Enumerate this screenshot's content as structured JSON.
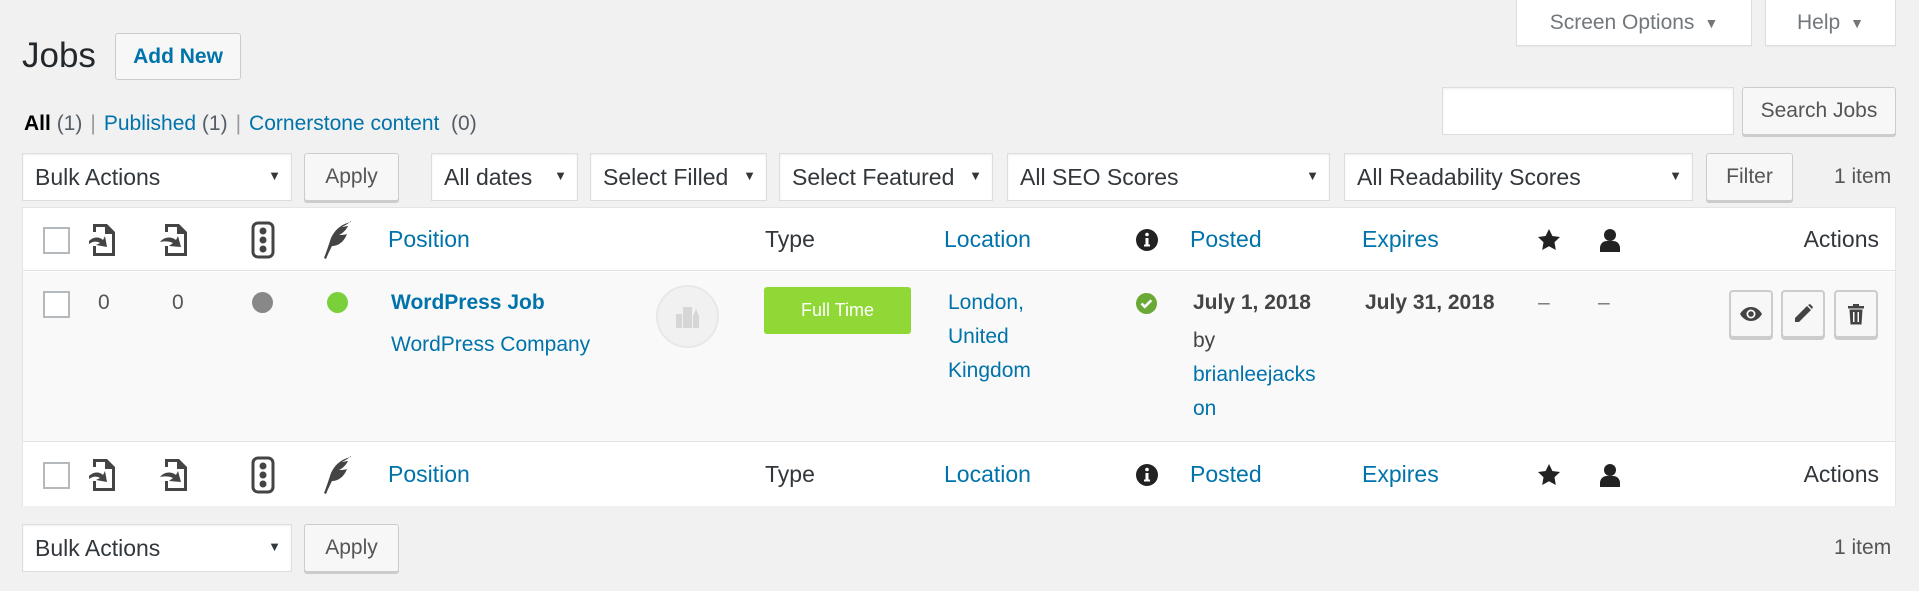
{
  "screen_meta": {
    "screen_options_label": "Screen Options",
    "help_label": "Help"
  },
  "header": {
    "title": "Jobs",
    "add_new_label": "Add New"
  },
  "views": [
    {
      "label": "All",
      "count": "(1)",
      "current": true
    },
    {
      "label": "Published",
      "count": "(1)",
      "current": false
    },
    {
      "label": "Cornerstone content",
      "count": "(0)",
      "current": false
    }
  ],
  "search": {
    "value": "",
    "placeholder": "",
    "button_label": "Search Jobs"
  },
  "tablenav_top": {
    "bulk_actions": "Bulk Actions",
    "apply_label": "Apply",
    "filters": {
      "dates": "All dates",
      "filled": "Select Filled",
      "featured": "Select Featured",
      "seo": "All SEO Scores",
      "readability": "All Readability Scores"
    },
    "filter_label": "Filter",
    "item_count": "1 item"
  },
  "columns": {
    "incoming_links_icon": "incoming-links-icon",
    "outgoing_links_icon": "outgoing-links-icon",
    "seo_score_icon": "traffic-light-icon",
    "readability_icon": "quill-icon",
    "position": "Position",
    "type": "Type",
    "location": "Location",
    "status_icon": "info-icon",
    "posted": "Posted",
    "expires": "Expires",
    "featured_icon": "star-icon",
    "filled_icon": "user-icon",
    "actions": "Actions"
  },
  "rows": [
    {
      "incoming_links": "0",
      "outgoing_links": "0",
      "seo_status_color": "#888888",
      "readability_status_color": "#7ad03a",
      "position_title": "WordPress Job",
      "company": "WordPress Company",
      "company_logo_icon": "building-icon",
      "type": "Full Time",
      "type_color": "#8fd835",
      "location_line1": "London,",
      "location_line2": "United",
      "location_line3": "Kingdom",
      "status_icon": "check-circle-icon",
      "posted_date": "July 1, 2018",
      "posted_by_prefix": "by",
      "posted_by_line1": "brianleejacks",
      "posted_by_line2": "on",
      "expires": "July 31, 2018",
      "featured": "–",
      "filled": "–",
      "actions": [
        "view",
        "edit",
        "delete"
      ]
    }
  ],
  "tablenav_bottom": {
    "bulk_actions": "Bulk Actions",
    "apply_label": "Apply",
    "item_count": "1 item"
  },
  "colors": {
    "link": "#0073aa",
    "background": "#f1f1f1",
    "status_green": "#7ad03a",
    "status_grey": "#888888"
  }
}
